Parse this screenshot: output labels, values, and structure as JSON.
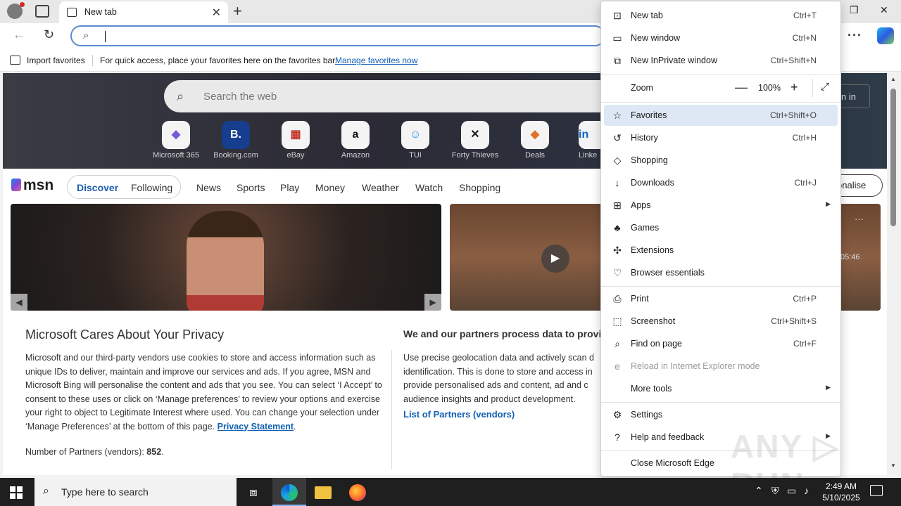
{
  "browser": {
    "tab_title": "New tab",
    "tab_close": "✕",
    "new_tab_glyph": "+",
    "address_placeholder": "",
    "more_glyph": "···"
  },
  "favorites_bar": {
    "import": "Import favorites",
    "message": "For quick access, place your favorites here on the favorites bar.",
    "manage_link": "Manage favorites now"
  },
  "newtab": {
    "search_placeholder": "Search the web",
    "signin_label": "n in",
    "tiles": [
      {
        "label": "Microsoft 365",
        "glyph": "◆",
        "icon": "microsoft-365-icon"
      },
      {
        "label": "Booking.com",
        "glyph": "B.",
        "icon": "booking-icon"
      },
      {
        "label": "eBay",
        "glyph": "▦",
        "icon": "ebay-icon"
      },
      {
        "label": "Amazon",
        "glyph": "a",
        "icon": "amazon-icon"
      },
      {
        "label": "TUI",
        "glyph": "☺",
        "icon": "tui-icon"
      },
      {
        "label": "Forty Thieves",
        "glyph": "✕",
        "icon": "forty-thieves-icon"
      },
      {
        "label": "Deals",
        "glyph": "◆",
        "icon": "deals-icon"
      },
      {
        "label": "Linke",
        "glyph": "in",
        "icon": "linkedin-icon"
      }
    ]
  },
  "msn": {
    "logo": "msn",
    "discover": "Discover",
    "following": "Following",
    "nav": [
      "News",
      "Sports",
      "Play",
      "Money",
      "Weather",
      "Watch",
      "Shopping"
    ],
    "personalise": "onalise",
    "video_time": "05:46",
    "card_menu": "···"
  },
  "privacy": {
    "title": "Microsoft Cares About Your Privacy",
    "body": "Microsoft and our third-party vendors use cookies to store and access information such as unique IDs to deliver, maintain and improve our services and ads. If you agree, MSN and Microsoft Bing will personalise the content and ads that you see. You can select ‘I Accept’ to consent to these uses or click on ‘Manage preferences’ to review your options and exercise your right to object to Legitimate Interest where used.  You can change your selection under ‘Manage Preferences’ at the bottom of this page.",
    "privacy_link": "Privacy Statement",
    "partners_label": "Number of Partners (vendors):",
    "partners_count": "852",
    "right_title": "We and our partners process data to provide:",
    "right_body": "Use precise geolocation data and actively scan d identification. This is done to store and access in provide personalised ads and content, ad and c audience insights and product development.",
    "list_link": "List of Partners (vendors)"
  },
  "menu": {
    "items": [
      {
        "label": "New tab",
        "shortcut": "Ctrl+T",
        "icon": "new-tab-icon",
        "glyph": "⊡"
      },
      {
        "label": "New window",
        "shortcut": "Ctrl+N",
        "icon": "new-window-icon",
        "glyph": "▭"
      },
      {
        "label": "New InPrivate window",
        "shortcut": "Ctrl+Shift+N",
        "icon": "inprivate-icon",
        "glyph": "⧉"
      },
      {
        "label": "Zoom",
        "shortcut": "",
        "icon": "",
        "glyph": ""
      },
      {
        "label": "Favorites",
        "shortcut": "Ctrl+Shift+O",
        "icon": "favorites-icon",
        "glyph": "☆"
      },
      {
        "label": "History",
        "shortcut": "Ctrl+H",
        "icon": "history-icon",
        "glyph": "↺"
      },
      {
        "label": "Shopping",
        "shortcut": "",
        "icon": "shopping-tag-icon",
        "glyph": "◇"
      },
      {
        "label": "Downloads",
        "shortcut": "Ctrl+J",
        "icon": "download-icon",
        "glyph": "↓"
      },
      {
        "label": "Apps",
        "shortcut": "",
        "icon": "apps-icon",
        "glyph": "⊞"
      },
      {
        "label": "Games",
        "shortcut": "",
        "icon": "games-icon",
        "glyph": "♣"
      },
      {
        "label": "Extensions",
        "shortcut": "",
        "icon": "extensions-icon",
        "glyph": "✣"
      },
      {
        "label": "Browser essentials",
        "shortcut": "",
        "icon": "heart-pulse-icon",
        "glyph": "♡"
      },
      {
        "label": "Print",
        "shortcut": "Ctrl+P",
        "icon": "print-icon",
        "glyph": "⎙"
      },
      {
        "label": "Screenshot",
        "shortcut": "Ctrl+Shift+S",
        "icon": "screenshot-icon",
        "glyph": "⬚"
      },
      {
        "label": "Find on page",
        "shortcut": "Ctrl+F",
        "icon": "find-icon",
        "glyph": "⌕"
      },
      {
        "label": "Reload in Internet Explorer mode",
        "shortcut": "",
        "icon": "ie-mode-icon",
        "glyph": "e"
      },
      {
        "label": "More tools",
        "shortcut": "",
        "icon": "",
        "glyph": ""
      },
      {
        "label": "Settings",
        "shortcut": "",
        "icon": "settings-gear-icon",
        "glyph": "⚙"
      },
      {
        "label": "Help and feedback",
        "shortcut": "",
        "icon": "help-icon",
        "glyph": "?"
      },
      {
        "label": "Close Microsoft Edge",
        "shortcut": "",
        "icon": "",
        "glyph": ""
      }
    ],
    "zoom_value": "100%",
    "zoom_minus": "—",
    "zoom_plus": "+",
    "fullscreen": "⤢",
    "submenu_arrow": "▶"
  },
  "watermark": "ANY ▷ RUN",
  "taskbar": {
    "search_placeholder": "Type here to search",
    "time": "2:49 AM",
    "date": "5/10/2025"
  }
}
